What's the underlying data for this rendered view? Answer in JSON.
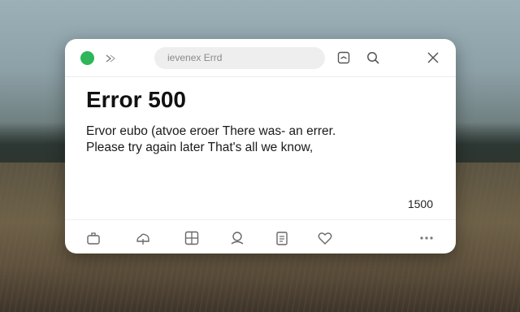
{
  "window": {
    "address_bar": "ievenex Errd",
    "title": "Error 500",
    "message_line1": "Ervor eubo (atvoe eroer There was- an errer.",
    "message_line2": "Please try again later That's all we know,",
    "code": "1500"
  },
  "icons": {
    "titlebar": [
      "green-dot-icon",
      "back-arrow-icon",
      "bookmark-icon",
      "search-icon",
      "close-icon"
    ],
    "bottombar": [
      "share-icon",
      "cloud-icon",
      "grid-icon",
      "profile-icon",
      "document-icon",
      "heart-icon",
      "more-icon"
    ]
  },
  "colors": {
    "accent_green": "#2fb55a",
    "text": "#111111"
  }
}
